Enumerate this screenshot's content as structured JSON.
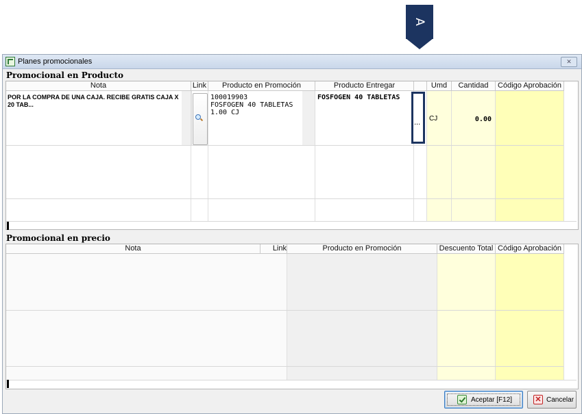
{
  "marker": {
    "label": "A"
  },
  "window": {
    "title": "Planes promocionales",
    "close_label": "✕"
  },
  "product_promo": {
    "section_title": "Promocional en Producto",
    "columns": [
      "Nota",
      "Link",
      "Producto en Promoción",
      "Producto Entregar",
      "",
      "Umd",
      "Cantidad",
      "Código Aprobación"
    ],
    "rows": [
      {
        "nota": "POR LA COMPRA DE UNA CAJA. RECIBE GRATIS CAJA X 20 TAB...",
        "producto_promocion": "100019903\nFOSFOGEN 40 TABLETAS\n1.00 CJ",
        "producto_entregar": "FOSFOGEN 40 TABLETAS",
        "selector": "...",
        "umd": "CJ",
        "cantidad": "0.00",
        "codigo_aprobacion": ""
      }
    ]
  },
  "price_promo": {
    "section_title": "Promocional en precio",
    "columns": [
      "Nota",
      "Link",
      "Producto en Promoción",
      "Descuento Total",
      "Código Aprobación"
    ]
  },
  "buttons": {
    "accept_label": "Aceptar [F12]",
    "cancel_label": "Cancelar"
  }
}
